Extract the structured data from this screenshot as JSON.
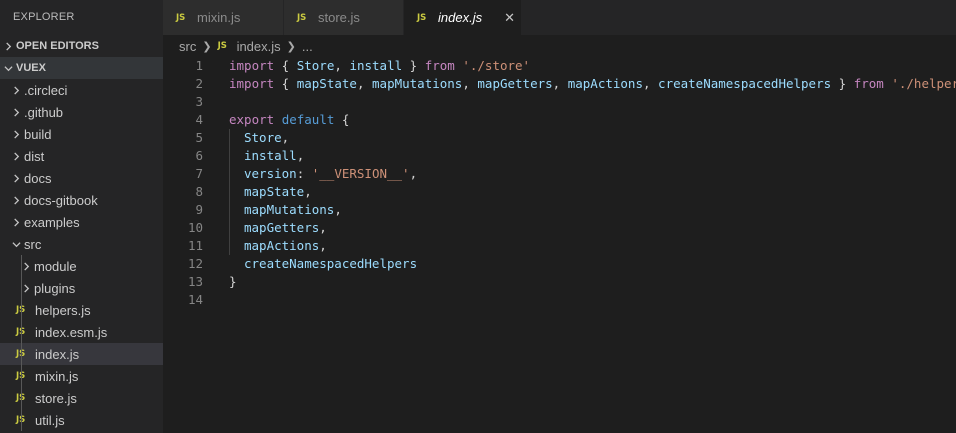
{
  "sidebar": {
    "title": "EXPLORER",
    "open_editors": "OPEN EDITORS",
    "project": "VUEX",
    "items": [
      {
        "label": ".circleci",
        "type": "folder"
      },
      {
        "label": ".github",
        "type": "folder"
      },
      {
        "label": "build",
        "type": "folder"
      },
      {
        "label": "dist",
        "type": "folder"
      },
      {
        "label": "docs",
        "type": "folder"
      },
      {
        "label": "docs-gitbook",
        "type": "folder"
      },
      {
        "label": "examples",
        "type": "folder"
      },
      {
        "label": "src",
        "type": "folder-open"
      },
      {
        "label": "module",
        "type": "folder"
      },
      {
        "label": "plugins",
        "type": "folder"
      },
      {
        "label": "helpers.js",
        "type": "js"
      },
      {
        "label": "index.esm.js",
        "type": "js"
      },
      {
        "label": "index.js",
        "type": "js"
      },
      {
        "label": "mixin.js",
        "type": "js"
      },
      {
        "label": "store.js",
        "type": "js"
      },
      {
        "label": "util.js",
        "type": "js"
      }
    ],
    "js_badge": "JS"
  },
  "tabs": [
    {
      "label": "mixin.js"
    },
    {
      "label": "store.js"
    },
    {
      "label": "index.js",
      "close": "✕"
    }
  ],
  "breadcrumb": {
    "folder": "src",
    "file": "index.js",
    "more": "..."
  },
  "code": {
    "line_numbers": [
      "1",
      "2",
      "3",
      "4",
      "5",
      "6",
      "7",
      "8",
      "9",
      "10",
      "11",
      "12",
      "13",
      "14"
    ],
    "l1": {
      "kw": "import",
      "p1": " { ",
      "a": "Store",
      "c": ", ",
      "b": "install",
      "p2": " } ",
      "from": "from",
      "sp": " ",
      "str": "'./store'"
    },
    "l2": {
      "kw": "import",
      "p1": " { ",
      "a": "mapState",
      "c1": ", ",
      "b": "mapMutations",
      "c2": ", ",
      "c": "mapGetters",
      "c3": ", ",
      "d": "mapActions",
      "c4": ", ",
      "e": "createNamespacedHelpers",
      "p2": " } ",
      "from": "from",
      "sp": " ",
      "str": "'./helpers'"
    },
    "l4": {
      "kw1": "export",
      "sp": " ",
      "kw2": "default",
      "p": " {"
    },
    "l5": {
      "v": "Store",
      "p": ","
    },
    "l6": {
      "v": "install",
      "p": ","
    },
    "l7": {
      "v": "version",
      "p1": ": ",
      "str": "'__VERSION__'",
      "p2": ","
    },
    "l8": {
      "v": "mapState",
      "p": ","
    },
    "l9": {
      "v": "mapMutations",
      "p": ","
    },
    "l10": {
      "v": "mapGetters",
      "p": ","
    },
    "l11": {
      "v": "mapActions",
      "p": ","
    },
    "l12": {
      "v": "createNamespacedHelpers"
    },
    "l13": {
      "p": "}"
    }
  }
}
